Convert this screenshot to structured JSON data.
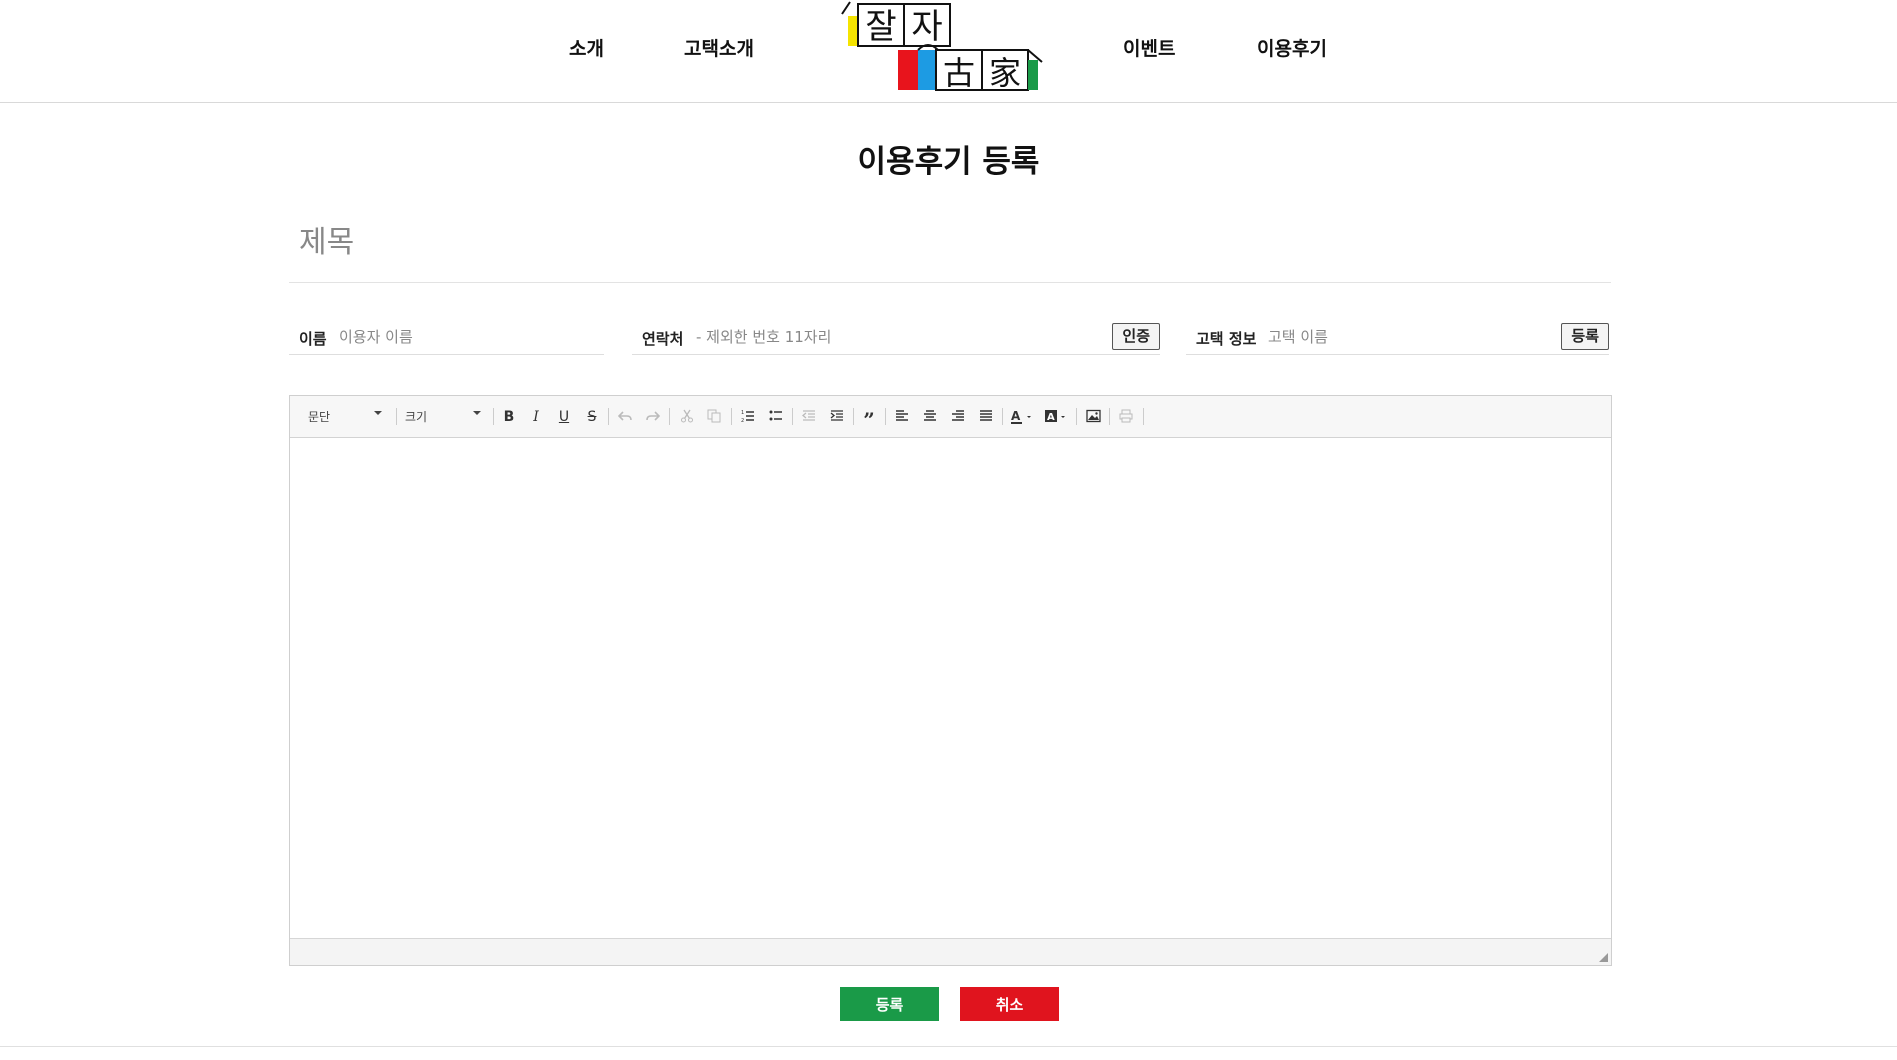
{
  "header": {
    "nav": [
      "소개",
      "고택소개",
      "이벤트",
      "이용후기"
    ],
    "logo": {
      "top_chars": [
        "잘",
        "자"
      ],
      "bottom_chars": [
        "古",
        "家"
      ],
      "colors": [
        "#f5e400",
        "#e8141c",
        "#1d9be3",
        "#1a9a48"
      ]
    }
  },
  "page": {
    "title": "이용후기 등록"
  },
  "form": {
    "subject_placeholder": "제목",
    "name": {
      "label": "이름",
      "placeholder": "이용자 이름"
    },
    "contact": {
      "label": "연락처",
      "placeholder": "- 제외한 번호 11자리",
      "button": "인증"
    },
    "house": {
      "label": "고택 정보",
      "placeholder": "고택 이름",
      "button": "등록"
    }
  },
  "editor": {
    "paragraph_select": "문단",
    "size_select": "크기",
    "tools": [
      "bold",
      "italic",
      "underline",
      "strikethrough",
      "undo",
      "redo",
      "cut",
      "copy",
      "ordered-list",
      "unordered-list",
      "outdent",
      "indent",
      "blockquote",
      "align-left",
      "align-center",
      "align-right",
      "align-justify",
      "font-color",
      "background-color",
      "image",
      "print"
    ]
  },
  "actions": {
    "submit": "등록",
    "cancel": "취소",
    "submit_color": "#1a9a48",
    "cancel_color": "#e0141e"
  }
}
